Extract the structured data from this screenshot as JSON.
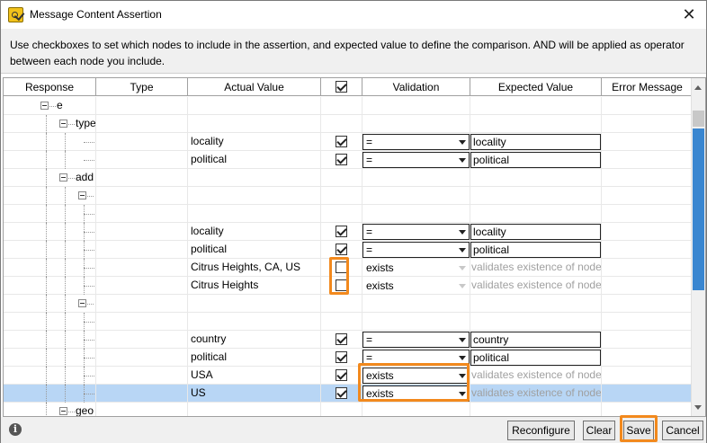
{
  "window": {
    "title": "Message Content Assertion",
    "close_symbol": "✕"
  },
  "instructions": "Use checkboxes to set which nodes to include in the assertion, and expected value to define the comparison. AND will be applied as operator between each node you include.",
  "columns": {
    "response": "Response",
    "type": "Type",
    "actual": "Actual Value",
    "validation": "Validation",
    "expected": "Expected Value",
    "error": "Error Message"
  },
  "rows": [
    {
      "tree": "e",
      "level": 0,
      "expander": true
    },
    {
      "tree": "type",
      "level": 1,
      "expander": true
    },
    {
      "tree": "",
      "level": 2,
      "actual": "locality",
      "checked": true,
      "validation": "=",
      "expected": "locality"
    },
    {
      "tree": "",
      "level": 2,
      "actual": "political",
      "checked": true,
      "validation": "=",
      "expected": "political"
    },
    {
      "tree": "add",
      "level": 1,
      "expander": true
    },
    {
      "tree": "",
      "level": 2,
      "expander": true
    },
    {
      "tree": "",
      "level": 3
    },
    {
      "tree": "",
      "level": 3,
      "actual": "locality",
      "checked": true,
      "validation": "=",
      "expected": "locality"
    },
    {
      "tree": "",
      "level": 3,
      "actual": "political",
      "checked": true,
      "validation": "=",
      "expected": "political"
    },
    {
      "tree": "",
      "level": 3,
      "actual": "Citrus Heights, CA, US",
      "checked": false,
      "validation": "exists",
      "hint": "validates existence of node"
    },
    {
      "tree": "",
      "level": 3,
      "actual": "Citrus Heights",
      "checked": false,
      "validation": "exists",
      "hint": "validates existence of node"
    },
    {
      "tree": "",
      "level": 2,
      "expander": true
    },
    {
      "tree": "",
      "level": 3
    },
    {
      "tree": "",
      "level": 3,
      "actual": "country",
      "checked": true,
      "validation": "=",
      "expected": "country"
    },
    {
      "tree": "",
      "level": 3,
      "actual": "political",
      "checked": true,
      "validation": "=",
      "expected": "political"
    },
    {
      "tree": "",
      "level": 3,
      "actual": "USA",
      "checked": true,
      "validation": "exists",
      "hint": "validates existence of node"
    },
    {
      "tree": "",
      "level": 3,
      "actual": "US",
      "checked": true,
      "validation": "exists",
      "hint": "validates existence of node",
      "selected": true
    },
    {
      "tree": "geo",
      "level": 1,
      "expander": true
    }
  ],
  "footer": {
    "info_icon": "i",
    "reconfigure": "Reconfigure",
    "clear": "Clear",
    "save": "Save",
    "cancel": "Cancel"
  },
  "colors": {
    "highlight": "#f2891d",
    "selection": "#b8d6f5",
    "scroll_thumb": "#3a86d0"
  }
}
